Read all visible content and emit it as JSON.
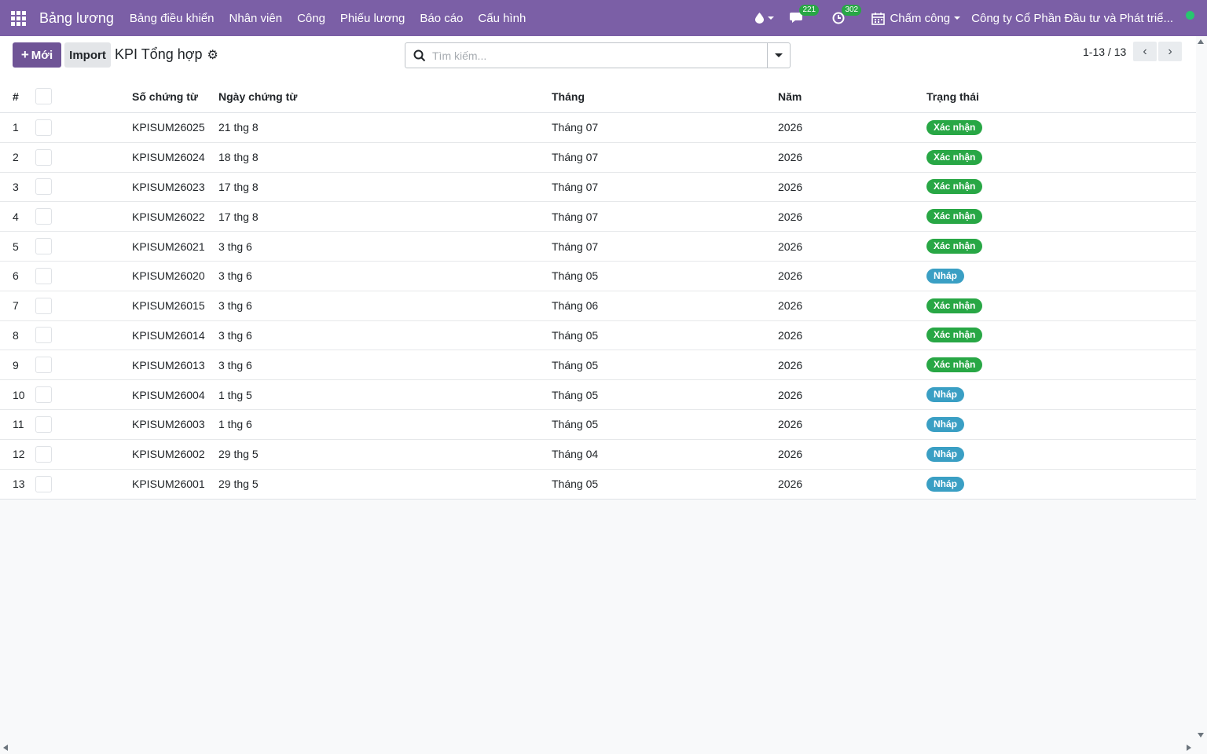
{
  "topbar": {
    "brand": "Bảng lương",
    "menu": [
      "Bảng điều khiển",
      "Nhân viên",
      "Công",
      "Phiếu lương",
      "Báo cáo",
      "Cấu hình"
    ],
    "messages_count": "221",
    "activities_count": "302",
    "attendance_label": "Chấm công",
    "company": "Công ty Cổ Phần Đầu tư và Phát triể..."
  },
  "control": {
    "new_label": "Mới",
    "import_label": "Import",
    "title": "KPI Tổng hợp",
    "search_placeholder": "Tìm kiếm...",
    "pager": "1-13 / 13"
  },
  "table": {
    "columns": {
      "num": "#",
      "doc": "Số chứng từ",
      "date": "Ngày chứng từ",
      "month": "Tháng",
      "year": "Năm",
      "state": "Trạng thái"
    },
    "rows": [
      {
        "num": "1",
        "doc": "KPISUM26025",
        "date": "21 thg 8",
        "month": "Tháng 07",
        "year": "2026",
        "state": "Xác nhận",
        "state_kind": "ok"
      },
      {
        "num": "2",
        "doc": "KPISUM26024",
        "date": "18 thg 8",
        "month": "Tháng 07",
        "year": "2026",
        "state": "Xác nhận",
        "state_kind": "ok"
      },
      {
        "num": "3",
        "doc": "KPISUM26023",
        "date": "17 thg 8",
        "month": "Tháng 07",
        "year": "2026",
        "state": "Xác nhận",
        "state_kind": "ok"
      },
      {
        "num": "4",
        "doc": "KPISUM26022",
        "date": "17 thg 8",
        "month": "Tháng 07",
        "year": "2026",
        "state": "Xác nhận",
        "state_kind": "ok"
      },
      {
        "num": "5",
        "doc": "KPISUM26021",
        "date": "3 thg 6",
        "month": "Tháng 07",
        "year": "2026",
        "state": "Xác nhận",
        "state_kind": "ok"
      },
      {
        "num": "6",
        "doc": "KPISUM26020",
        "date": "3 thg 6",
        "month": "Tháng 05",
        "year": "2026",
        "state": "Nháp",
        "state_kind": "draft"
      },
      {
        "num": "7",
        "doc": "KPISUM26015",
        "date": "3 thg 6",
        "month": "Tháng 06",
        "year": "2026",
        "state": "Xác nhận",
        "state_kind": "ok"
      },
      {
        "num": "8",
        "doc": "KPISUM26014",
        "date": "3 thg 6",
        "month": "Tháng 05",
        "year": "2026",
        "state": "Xác nhận",
        "state_kind": "ok"
      },
      {
        "num": "9",
        "doc": "KPISUM26013",
        "date": "3 thg 6",
        "month": "Tháng 05",
        "year": "2026",
        "state": "Xác nhận",
        "state_kind": "ok"
      },
      {
        "num": "10",
        "doc": "KPISUM26004",
        "date": "1 thg 5",
        "month": "Tháng 05",
        "year": "2026",
        "state": "Nháp",
        "state_kind": "draft"
      },
      {
        "num": "11",
        "doc": "KPISUM26003",
        "date": "1 thg 6",
        "month": "Tháng 05",
        "year": "2026",
        "state": "Nháp",
        "state_kind": "draft"
      },
      {
        "num": "12",
        "doc": "KPISUM26002",
        "date": "29 thg 5",
        "month": "Tháng 04",
        "year": "2026",
        "state": "Nháp",
        "state_kind": "draft"
      },
      {
        "num": "13",
        "doc": "KPISUM26001",
        "date": "29 thg 5",
        "month": "Tháng 05",
        "year": "2026",
        "state": "Nháp",
        "state_kind": "draft"
      }
    ]
  }
}
